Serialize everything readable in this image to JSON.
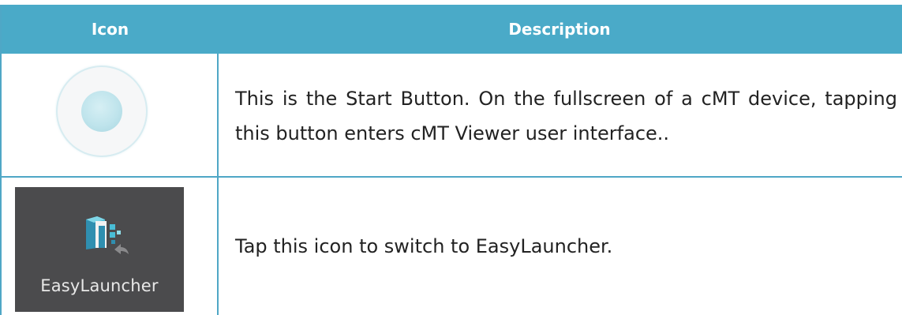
{
  "table": {
    "header": {
      "icon_label": "Icon",
      "description_label": "Description"
    },
    "rows": [
      {
        "icon_name": "start-button-icon",
        "description": "This is the Start Button. On the fullscreen of a cMT device, tapping this button enters cMT Viewer user interface.."
      },
      {
        "icon_name": "easylauncher-icon",
        "icon_label": "EasyLauncher",
        "description": "Tap this icon to switch to EasyLauncher."
      }
    ]
  },
  "colors": {
    "header_background": "#4aaac8",
    "border": "#4fa7c6",
    "header_text": "#ffffff",
    "easylauncher_background": "#4b4b4d",
    "easylauncher_accent": "#3fb4cf"
  }
}
